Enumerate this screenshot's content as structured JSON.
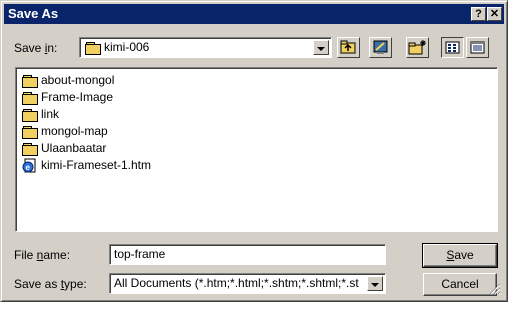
{
  "window": {
    "title": "Save As"
  },
  "titlebar": {
    "help": "?",
    "close": "✕"
  },
  "save_in": {
    "label_pre": "Save ",
    "label_key": "i",
    "label_post": "n:",
    "value": "kimi-006"
  },
  "toolbar": {
    "icons": [
      "up-one-level-icon",
      "desktop-icon",
      "new-folder-icon",
      "list-view-icon",
      "details-view-icon"
    ]
  },
  "files": [
    {
      "name": "about-mongol",
      "type": "folder"
    },
    {
      "name": "Frame-Image",
      "type": "folder"
    },
    {
      "name": "link",
      "type": "folder"
    },
    {
      "name": "mongol-map",
      "type": "folder"
    },
    {
      "name": "Ulaanbaatar",
      "type": "folder"
    },
    {
      "name": "kimi-Frameset-1.htm",
      "type": "htm"
    }
  ],
  "file_name": {
    "label_pre": "File ",
    "label_key": "n",
    "label_post": "ame:",
    "value": "top-frame"
  },
  "save_as_type": {
    "label_pre": "Save as ",
    "label_key": "t",
    "label_post": "ype:",
    "value": "All Documents (*.htm;*.html;*.shtm;*.shtml;*.st"
  },
  "buttons": {
    "save_key": "S",
    "save_rest": "ave",
    "cancel": "Cancel"
  },
  "colors": {
    "title_bar": "#0a246a",
    "face": "#d4d0c8",
    "folder": "#f0d060"
  }
}
